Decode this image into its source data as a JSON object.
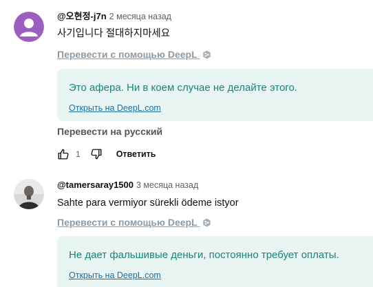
{
  "comments": [
    {
      "author": "@오현정-j7n",
      "time": "2 месяца назад",
      "text": "사기입니다 절대하지마세요",
      "translate_link": "Перевести с помощью DeepL",
      "translation": "Это афера. Ни в коем случае не делайте этого.",
      "open_link": "Открыть на DeepL.com",
      "translate_ru": "Перевести на русский",
      "likes": "1",
      "reply_label": "Ответить",
      "avatar_color": "#9c5ec0"
    },
    {
      "author": "@tamersaray1500",
      "time": "3 месяца назад",
      "text": "Sahte para vermiyor sürekli ödeme istyor",
      "translate_link": "Перевести с помощью DeepL",
      "translation": "Не дает фальшивые деньги, постоянно требует оплаты.",
      "open_link": "Открыть на DeepL.com"
    }
  ],
  "colors": {
    "translation_bg": "#e9f5f3",
    "translation_text": "#1b8377",
    "link": "#1b6fa1"
  },
  "icons": {
    "deepl": "deepl-icon",
    "like": "thumb-up-icon",
    "dislike": "thumb-down-icon"
  }
}
